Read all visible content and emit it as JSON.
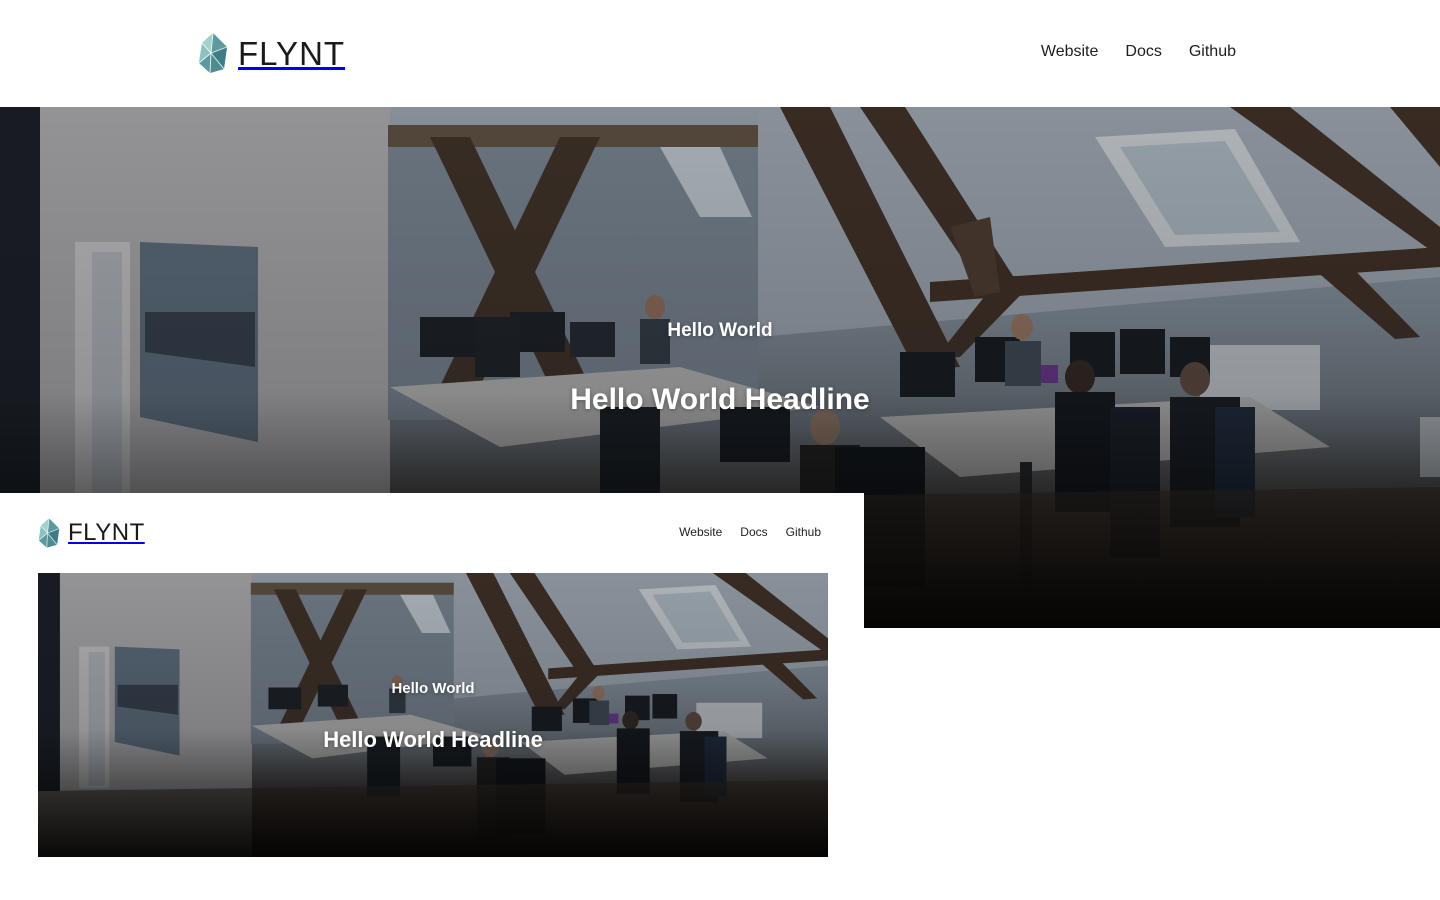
{
  "brand": {
    "name": "FLYNT",
    "logo_colors": [
      "#5c9aa0",
      "#7fb8b8",
      "#3f7c86",
      "#a6d0cc"
    ]
  },
  "nav": {
    "items": [
      "Website",
      "Docs",
      "Github"
    ]
  },
  "hero": {
    "pre_title": "Hello World",
    "headline": "Hello World Headline"
  }
}
